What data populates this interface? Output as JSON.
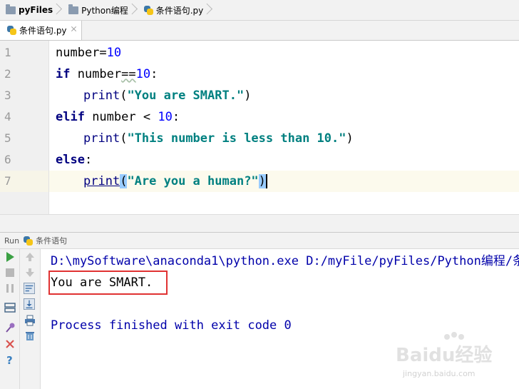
{
  "breadcrumb": {
    "items": [
      "pyFiles",
      "Python编程",
      "条件语句.py"
    ]
  },
  "tab": {
    "label": "条件语句.py"
  },
  "editor": {
    "line_numbers": [
      "1",
      "2",
      "3",
      "4",
      "5",
      "6",
      "7"
    ],
    "code": {
      "l1_name": "number",
      "l1_eq": "=",
      "l1_val": "10",
      "l2_kw": "if",
      "l2_name": " number",
      "l2_op": "==",
      "l2_val": "10",
      "l2_colon": ":",
      "l3_fn": "print",
      "l3_open": "(",
      "l3_str": "\"You are SMART.\"",
      "l3_close": ")",
      "l4_kw": "elif",
      "l4_name": " number ",
      "l4_op": "<",
      "l4_sp": " ",
      "l4_val": "10",
      "l4_colon": ":",
      "l5_fn": "print",
      "l5_open": "(",
      "l5_str": "\"This number is less than 10.\"",
      "l5_close": ")",
      "l6_kw": "else",
      "l6_colon": ":",
      "l7_fn": "print",
      "l7_open": "(",
      "l7_str": "\"Are you a human?\"",
      "l7_close": ")"
    }
  },
  "run_panel": {
    "label": "Run",
    "config_name": "条件语句",
    "console": {
      "command": "D:\\mySoftware\\anaconda1\\python.exe D:/myFile/pyFiles/Python编程/条",
      "output": "You are SMART.",
      "exit_message": "Process finished with exit code 0"
    }
  },
  "watermark": {
    "brand": "Baidu经验",
    "url": "jingyan.baidu.com"
  },
  "colors": {
    "keyword": "#000080",
    "number": "#0000ff",
    "string": "#008080",
    "console_path": "#0000aa",
    "highlight_box": "#e03232"
  }
}
